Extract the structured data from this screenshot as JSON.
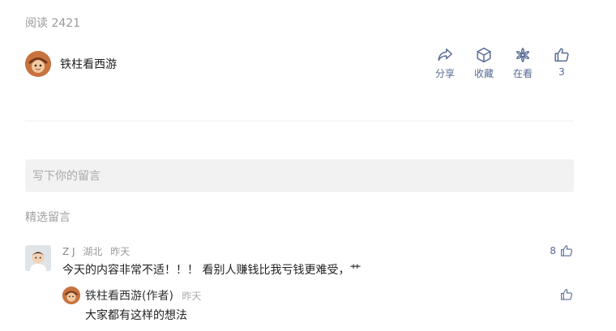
{
  "article": {
    "read_label": "阅读",
    "read_count": "2421"
  },
  "author": {
    "name": "铁柱看西游"
  },
  "actions": {
    "share": {
      "label": "分享",
      "icon": "share-icon"
    },
    "collect": {
      "label": "收藏",
      "icon": "cube-icon"
    },
    "watching": {
      "label": "在看",
      "icon": "flower-icon"
    },
    "like": {
      "label": "3",
      "icon": "thumbs-up-icon"
    }
  },
  "comment_box": {
    "placeholder": "写下你的留言"
  },
  "featured": {
    "title": "精选留言"
  },
  "comments": [
    {
      "user": "Z J",
      "location": "湖北",
      "time": "昨天",
      "text": "今天的内容非常不适！！！ 看别人赚钱比我亏钱更难受，艹",
      "likes": "8",
      "reply": {
        "author": "铁柱看西游(作者)",
        "time": "昨天",
        "text": "大家都有这样的想法"
      }
    }
  ],
  "colors": {
    "link": "#576b95",
    "muted": "#9a9a9a",
    "input_bg": "#f2f2f2"
  }
}
